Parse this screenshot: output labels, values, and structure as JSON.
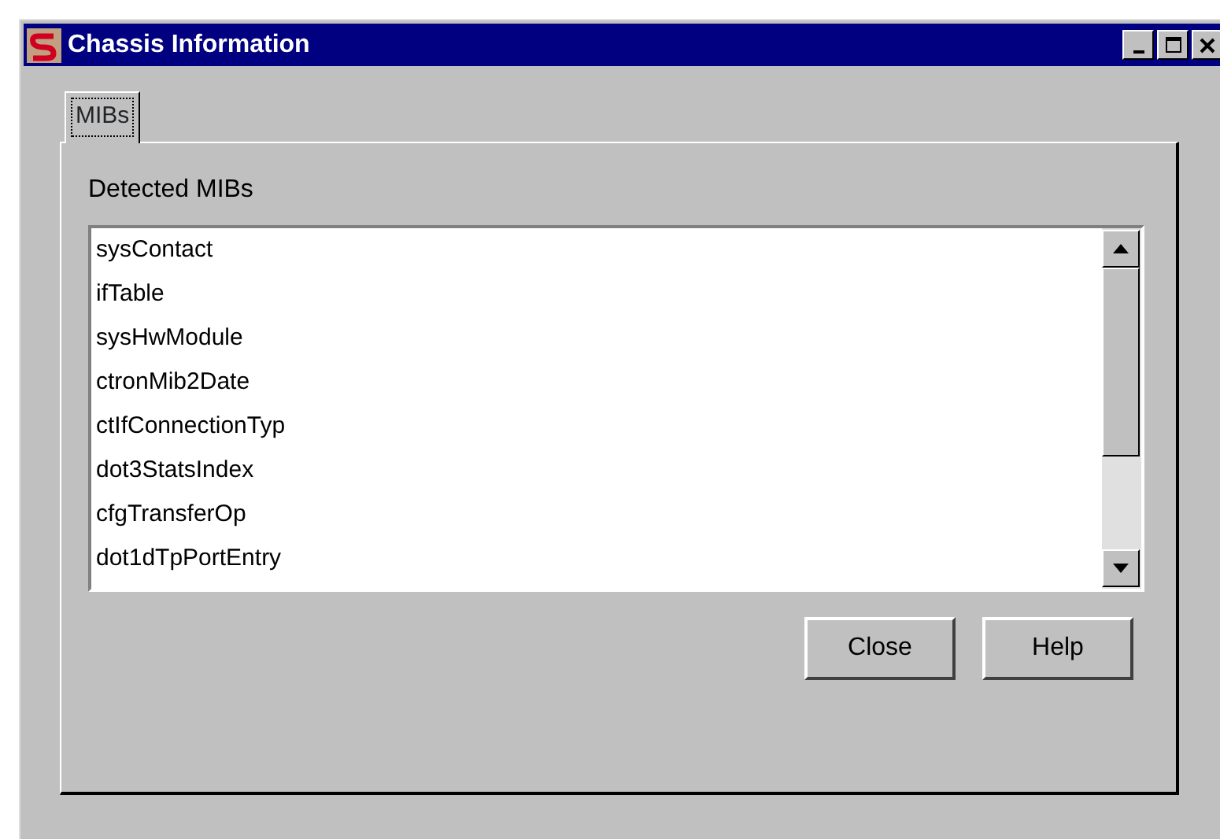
{
  "window": {
    "title": "Chassis Information"
  },
  "tabs": [
    {
      "label": "MIBs",
      "selected": true
    }
  ],
  "list": {
    "label": "Detected MIBs",
    "items": [
      {
        "text": "sysContact",
        "selected": false
      },
      {
        "text": "ifTable",
        "selected": false
      },
      {
        "text": "sysHwModule",
        "selected": false
      },
      {
        "text": "ctronMib2Date",
        "selected": false
      },
      {
        "text": "ctIfConnectionTyp",
        "selected": false
      },
      {
        "text": "dot3StatsIndex",
        "selected": false
      },
      {
        "text": "cfgTransferOp",
        "selected": false
      },
      {
        "text": "dot1dTpPortEntry",
        "selected": false
      }
    ]
  },
  "buttons": [
    "Close",
    "Help"
  ]
}
